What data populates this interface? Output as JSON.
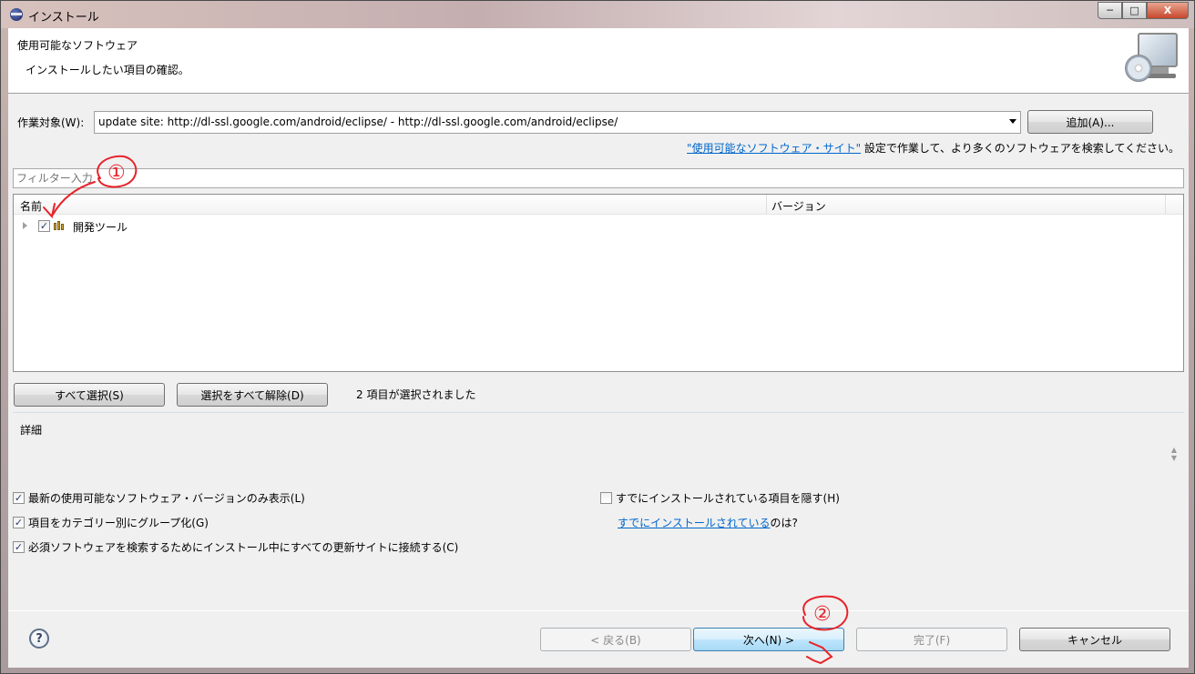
{
  "window": {
    "title": "インストール",
    "controls": {
      "minimize": "─",
      "maximize": "□",
      "close": "X"
    }
  },
  "banner": {
    "title": "使用可能なソフトウェア",
    "subtitle": "インストールしたい項目の確認。"
  },
  "work_with": {
    "label": "作業対象(W):",
    "value": "update site: http://dl-ssl.google.com/android/eclipse/ - http://dl-ssl.google.com/android/eclipse/",
    "add_button": "追加(A)...",
    "hint_link": "\"使用可能なソフトウェア・サイト\"",
    "hint_text": " 設定で作業して、より多くのソフトウェアを検索してください。"
  },
  "filter": {
    "placeholder": "フィルター入力"
  },
  "tree": {
    "columns": {
      "name": "名前",
      "version": "バージョン"
    },
    "items": [
      {
        "name": "開発ツール",
        "version": "",
        "checked": true
      }
    ]
  },
  "selection": {
    "select_all": "すべて選択(S)",
    "deselect_all": "選択をすべて解除(D)",
    "status": "2 項目が選択されました"
  },
  "details": {
    "label": "詳細"
  },
  "options": {
    "latest_only": {
      "label": "最新の使用可能なソフトウェア・バージョンのみ表示(L)",
      "checked": true
    },
    "group_by_category": {
      "label": "項目をカテゴリー別にグループ化(G)",
      "checked": true
    },
    "contact_all_sites": {
      "label": "必須ソフトウェアを検索するためにインストール中にすべての更新サイトに接続する(C)",
      "checked": true
    },
    "hide_installed": {
      "label": "すでにインストールされている項目を隠す(H)",
      "checked": false
    },
    "installed_link": "すでにインストールされている",
    "installed_suffix": " のは?"
  },
  "footer": {
    "help": "?",
    "back": "< 戻る(B)",
    "next": "次へ(N) >",
    "finish": "完了(F)",
    "cancel": "キャンセル"
  },
  "annotations": {
    "first": "①",
    "second": "②"
  },
  "colors": {
    "accent": "#3c7fb1",
    "link": "#0066cc",
    "annotation": "#e8232a"
  }
}
